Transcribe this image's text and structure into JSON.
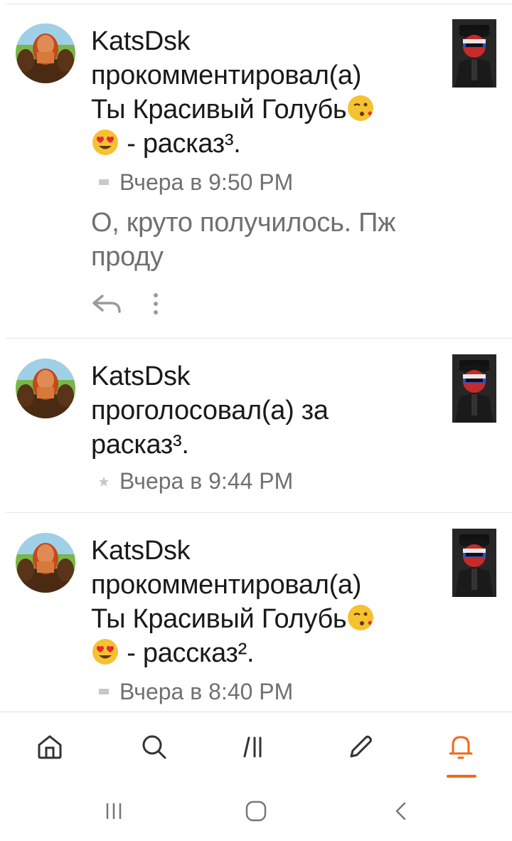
{
  "notifications": [
    {
      "user": "KatsDsk",
      "line1": "прокомментировал(а)",
      "line2": "Ты Красивый Голубь",
      "line3_suffix": "- расказ³.",
      "time": "Вчера в 9:50 PM",
      "meta_icon": "comment-icon",
      "excerpt_line1": "О, круто получилось. Пж",
      "excerpt_line2": "проду"
    },
    {
      "user": "KatsDsk",
      "line1": "проголосовал(а) за",
      "line2": "расказ³.",
      "time": "Вчера в 9:44 PM",
      "meta_icon": "star-icon"
    },
    {
      "user": "KatsDsk",
      "line1": "прокомментировал(а)",
      "line2": "Ты Красивый Голубь",
      "line3_suffix": "- рассказ².",
      "time": "Вчера в 8:40 PM",
      "meta_icon": "comment-icon"
    }
  ],
  "tabbar": {
    "items": [
      "home-icon",
      "search-icon",
      "library-icon",
      "write-icon",
      "notifications-icon"
    ],
    "active": "notifications-icon",
    "accent_color": "#ee6a17"
  },
  "system_nav": [
    "recent-apps-icon",
    "home-button-icon",
    "back-icon"
  ]
}
